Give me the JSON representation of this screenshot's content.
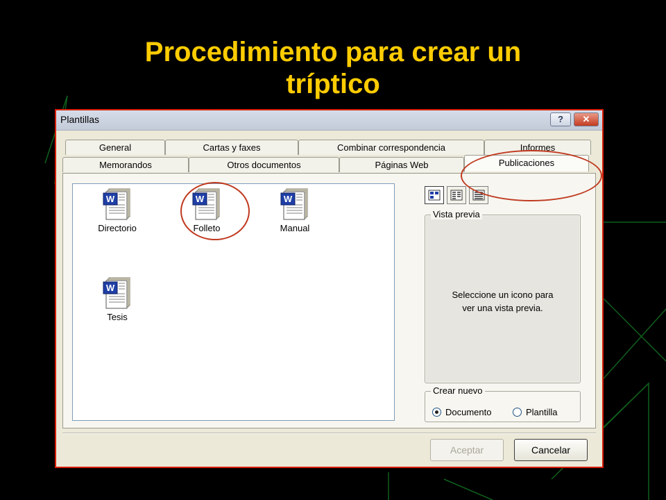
{
  "slide": {
    "title_line1": "Procedimiento para crear un",
    "title_line2": "tríptico"
  },
  "dialog": {
    "title": "Plantillas",
    "help_label": "?",
    "close_label": "✕",
    "tabs_back": [
      "General",
      "Cartas y faxes",
      "Combinar correspondencia",
      "Informes"
    ],
    "tabs_front": [
      "Memorandos",
      "Otros documentos",
      "Páginas Web",
      "Publicaciones"
    ],
    "active_tab": "Publicaciones",
    "templates": [
      {
        "label": "Directorio",
        "icon": "word-document-icon"
      },
      {
        "label": "Folleto",
        "icon": "word-document-icon"
      },
      {
        "label": "Manual",
        "icon": "word-document-icon"
      },
      {
        "label": "Tesis",
        "icon": "word-document-icon"
      }
    ],
    "view_buttons": [
      "large-icons-view-icon",
      "list-view-icon",
      "details-view-icon"
    ],
    "preview": {
      "legend": "Vista previa",
      "message_line1": "Seleccione un icono para",
      "message_line2": "ver una vista previa."
    },
    "create_new": {
      "legend": "Crear nuevo",
      "options": [
        "Documento",
        "Plantilla"
      ],
      "selected": "Documento"
    },
    "buttons": {
      "ok": "Aceptar",
      "cancel": "Cancelar"
    },
    "ok_enabled": false
  },
  "colors": {
    "title": "#ffcc00",
    "highlight_ring": "#c0391f",
    "dialog_border": "#d81e05",
    "word_blue": "#1f3fa6"
  }
}
